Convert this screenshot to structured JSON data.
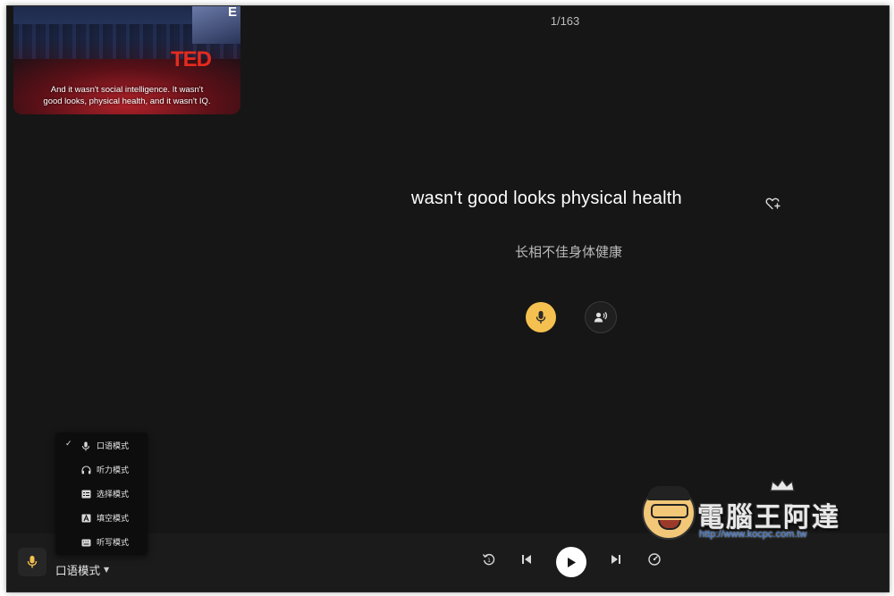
{
  "video": {
    "subtitle_line1": "And it wasn't social intelligence. It wasn't",
    "subtitle_line2": "good looks, physical health, and it wasn't IQ.",
    "logo_text": "TED",
    "screen_text": "E"
  },
  "counter": {
    "current": "1",
    "separator": "/",
    "total": "163"
  },
  "sentence": {
    "text": "wasn't good looks physical health",
    "favorite_icon": "heart-plus-icon"
  },
  "translation": "长相不佳身体健康",
  "actions": {
    "record_icon": "microphone-icon",
    "record_color": "#f4c04f",
    "listen_icon": "speaker-person-icon"
  },
  "mode_menu": {
    "items": [
      {
        "label": "口语模式",
        "icon": "microphone-icon",
        "selected": true
      },
      {
        "label": "听力模式",
        "icon": "headphones-icon",
        "selected": false
      },
      {
        "label": "选择模式",
        "icon": "checklist-icon",
        "selected": false
      },
      {
        "label": "填空模式",
        "icon": "letter-a-icon",
        "selected": false
      },
      {
        "label": "听写模式",
        "icon": "keyboard-icon",
        "selected": false
      }
    ],
    "check_mark": "✓"
  },
  "bottom_bar": {
    "current_mode": "口语模式",
    "controls": [
      "replay-icon",
      "previous-icon",
      "play-icon",
      "next-icon",
      "speed-icon"
    ]
  },
  "watermark": {
    "title": "電腦王阿達",
    "url": "http://www.kocpc.com.tw"
  }
}
